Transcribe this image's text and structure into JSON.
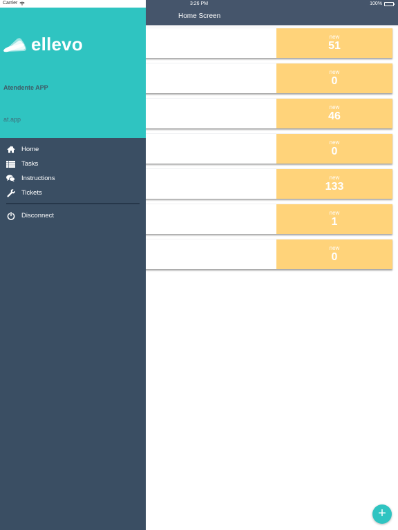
{
  "status_bar": {
    "carrier": "Carrier",
    "time": "3:26 PM",
    "battery": "100%"
  },
  "navbar": {
    "title": "Home Screen"
  },
  "drawer": {
    "logo_text": "ellevo",
    "app_name": "Atendente APP",
    "user": "at.app",
    "menu": [
      {
        "label": "Home",
        "icon": "home-icon"
      },
      {
        "label": "Tasks",
        "icon": "list-icon"
      },
      {
        "label": "Instructions",
        "icon": "chat-bubbles-icon"
      },
      {
        "label": "Tickets",
        "icon": "wrench-icon"
      }
    ],
    "disconnect": {
      "label": "Disconnect",
      "icon": "power-icon"
    }
  },
  "cards": [
    {
      "badge_label": "new",
      "count": "51"
    },
    {
      "badge_label": "new",
      "count": "0"
    },
    {
      "badge_label": "new",
      "count": "46"
    },
    {
      "badge_label": "new",
      "count": "0"
    },
    {
      "badge_label": "new",
      "count": "133"
    },
    {
      "badge_label": "new",
      "count": "1"
    },
    {
      "badge_label": "new",
      "count": "0"
    }
  ],
  "fab": {
    "icon": "plus-icon",
    "symbol": "+"
  },
  "colors": {
    "teal": "#2fc4c1",
    "drawer_bg": "#3a4e63",
    "navbar_bg": "#45556b",
    "badge_bg": "#ffd37a"
  }
}
